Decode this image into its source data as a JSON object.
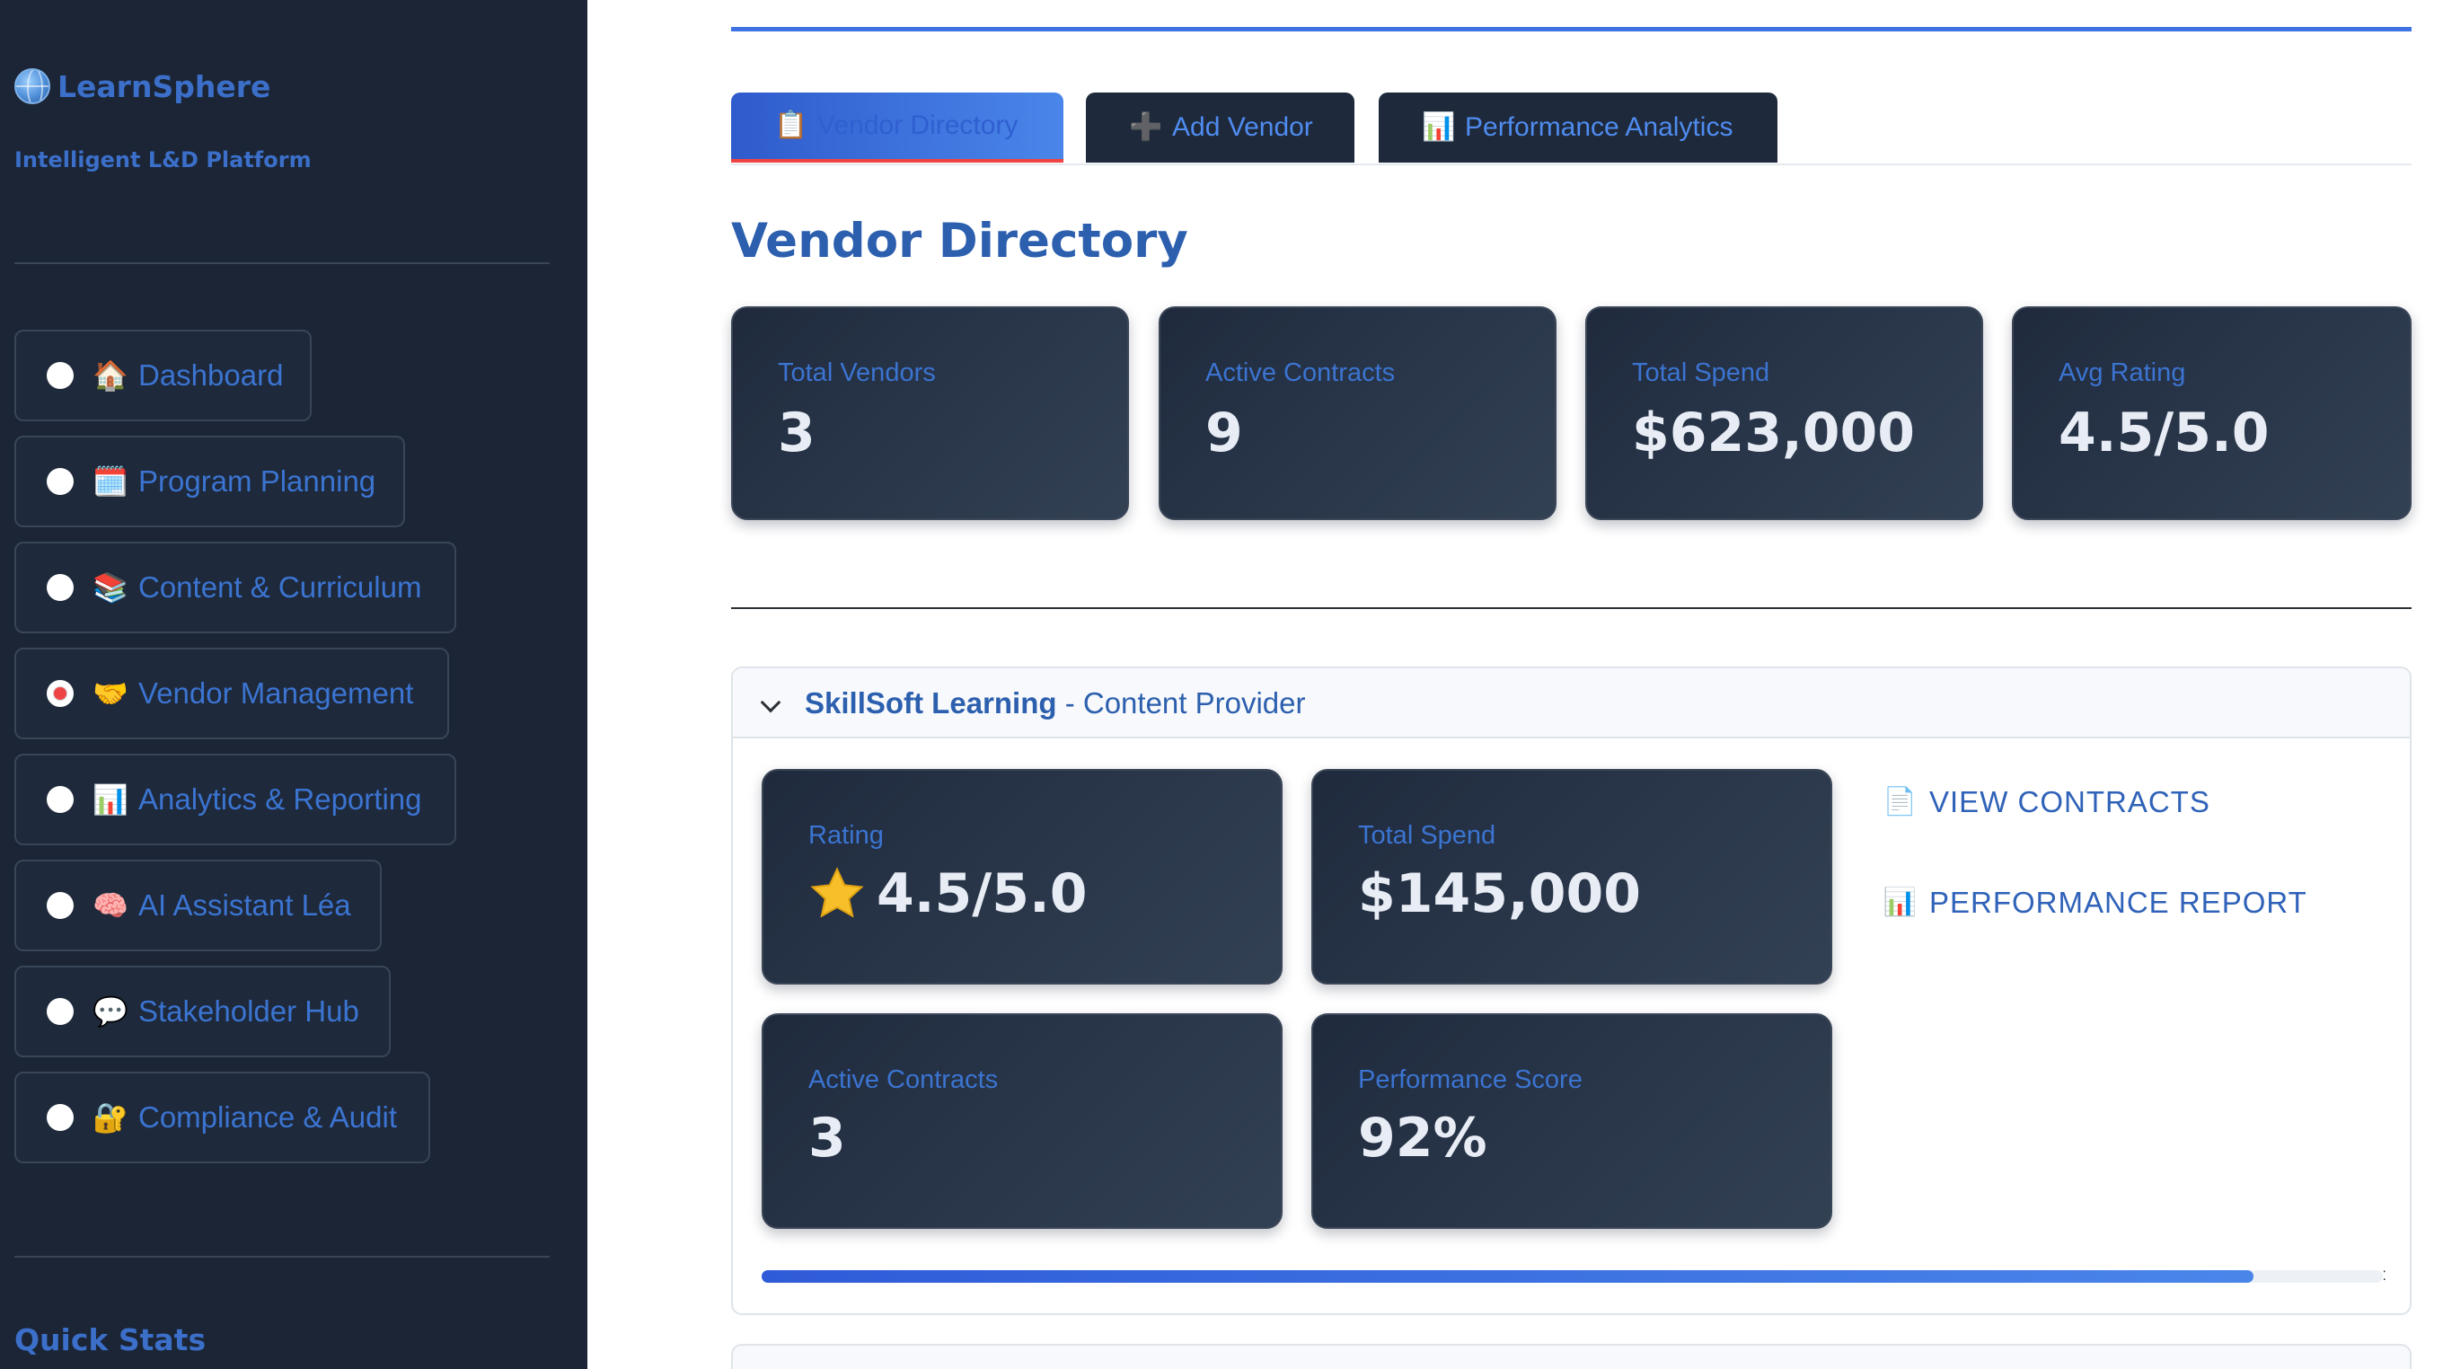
{
  "app": {
    "brand": "LearnSphere",
    "tagline": "Intelligent L&D Platform"
  },
  "sidebar": {
    "items": [
      {
        "label": "Dashboard",
        "icon": "house-icon",
        "glyph": "🏠",
        "active": false
      },
      {
        "label": "Program Planning",
        "icon": "calendar-icon",
        "glyph": "🗓️",
        "active": false
      },
      {
        "label": "Content & Curriculum",
        "icon": "books-icon",
        "glyph": "📚",
        "active": false
      },
      {
        "label": "Vendor Management",
        "icon": "handshake-icon",
        "glyph": "🤝",
        "active": true
      },
      {
        "label": "Analytics & Reporting",
        "icon": "bar-chart-icon",
        "glyph": "📊",
        "active": false
      },
      {
        "label": "AI Assistant Léa",
        "icon": "brain-icon",
        "glyph": "🧠",
        "active": false
      },
      {
        "label": "Stakeholder Hub",
        "icon": "speech-bubble-icon",
        "glyph": "💬",
        "active": false
      },
      {
        "label": "Compliance & Audit",
        "icon": "lock-key-icon",
        "glyph": "🔐",
        "active": false
      }
    ],
    "quick_stats_title": "Quick Stats"
  },
  "tabs": [
    {
      "label": "Vendor Directory",
      "icon": "clipboard-icon",
      "glyph": "📋",
      "active": true
    },
    {
      "label": "Add Vendor",
      "icon": "plus-icon",
      "glyph": "➕",
      "active": false
    },
    {
      "label": "Performance Analytics",
      "icon": "bar-chart-icon",
      "glyph": "📊",
      "active": false
    }
  ],
  "main": {
    "title": "Vendor Directory",
    "metrics": [
      {
        "label": "Total Vendors",
        "value": "3"
      },
      {
        "label": "Active Contracts",
        "value": "9"
      },
      {
        "label": "Total Spend",
        "value": "$623,000"
      },
      {
        "label": "Avg Rating",
        "value": "4.5/5.0"
      }
    ]
  },
  "vendor": {
    "name": "SkillSoft Learning",
    "type": " - Content Provider",
    "rating_label": "Rating",
    "rating_value": "4.5/5.0",
    "rating_icon": "star-icon",
    "spend_label": "Total Spend",
    "spend_value": "$145,000",
    "contracts_label": "Active Contracts",
    "contracts_value": "3",
    "score_label": "Performance Score",
    "score_value": "92%",
    "score_fraction": 0.92,
    "actions": [
      {
        "label": "VIEW CONTRACTS",
        "icon": "document-icon",
        "glyph": "📄"
      },
      {
        "label": "PERFORMANCE REPORT",
        "icon": "bar-chart-icon",
        "glyph": "📊"
      }
    ]
  },
  "colors": {
    "sidebar_bg": "#1b2535",
    "accent_blue": "#3f73e3",
    "card_bg": "#1f2a3d",
    "active_radio": "#ef4444",
    "link_text": "#2f62b8"
  }
}
